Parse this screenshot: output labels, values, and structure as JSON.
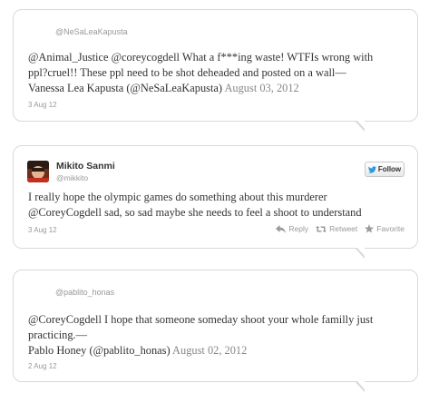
{
  "tweets": [
    {
      "handle": "@NeSaLeaKapusta",
      "text_line1_a": "@Animal_Justice ",
      "text_line1_b": "@coreycogdell",
      "text_line1_c": " What a f***ing waste! WTFIs wrong with",
      "text_line2": "ppl?cruel!! These ppl need to be shot deheaded and posted on a wall—",
      "text_line3_a": "Vanessa Lea Kapusta (@NeSaLeaKapusta) ",
      "text_line3_b": "August 03, 2012",
      "date": "3 Aug 12"
    },
    {
      "name": "Mikito Sanmi",
      "handle": "@mikkito",
      "follow_label": "Follow",
      "text_line1": "I really hope the olympic games do something about this murderer",
      "text_line2": "@CoreyCogdell sad, so sad maybe she needs to feel a shoot to understand",
      "date": "3 Aug 12",
      "actions": {
        "reply": "Reply",
        "retweet": "Retweet",
        "favorite": "Favorite"
      }
    },
    {
      "handle": "@pablito_honas",
      "text_line1": "@CoreyCogdell I hope that someone someday shoot your whole familly just",
      "text_line2": "practicing.—",
      "text_line3_a": "Pablo Honey (@pablito_honas) ",
      "text_line3_b": "August 02, 2012",
      "date": "2 Aug 12"
    }
  ],
  "colors": {
    "twitter_blue": "#2b9ae0",
    "border": "#d9d9d9",
    "muted": "#999999"
  }
}
